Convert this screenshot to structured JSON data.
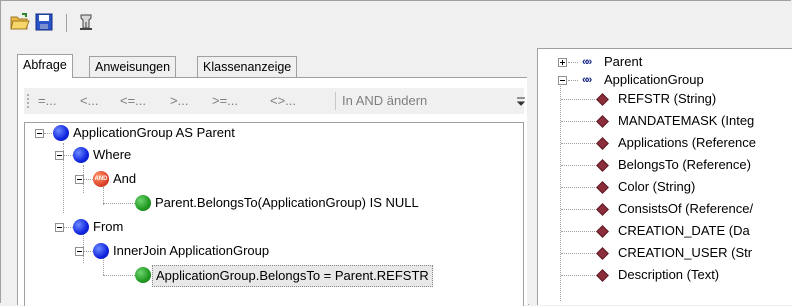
{
  "toolbar": {
    "icons": [
      "open-folder-icon",
      "save-icon",
      "filter-icon"
    ]
  },
  "tabs": [
    {
      "label": "Abfrage",
      "active": true
    },
    {
      "label": "Anweisungen",
      "active": false
    },
    {
      "label": "Klassenanzeige",
      "active": false
    }
  ],
  "operators": {
    "eq": "=...",
    "lt": "<...",
    "le": "<=...",
    "gt": ">...",
    "ge": ">=...",
    "ne": "<>...",
    "change_to_and": "In AND ändern"
  },
  "query_tree": {
    "root": "ApplicationGroup AS Parent",
    "where": "Where",
    "and": "And",
    "and_badge": "AND",
    "condition": "Parent.BelongsTo(ApplicationGroup) IS NULL",
    "from": "From",
    "join": "InnerJoin  ApplicationGroup",
    "join_condition": "ApplicationGroup.BelongsTo = Parent.REFSTR"
  },
  "class_tree": {
    "parent": "Parent",
    "group": "ApplicationGroup",
    "properties": [
      "REFSTR (String)",
      "MANDATEMASK (Integ",
      "Applications (Reference",
      "BelongsTo (Reference)",
      "Color (String)",
      "ConsistsOf (Reference/",
      "CREATION_DATE (Da",
      "CREATION_USER (Str",
      "Description (Text)"
    ]
  }
}
